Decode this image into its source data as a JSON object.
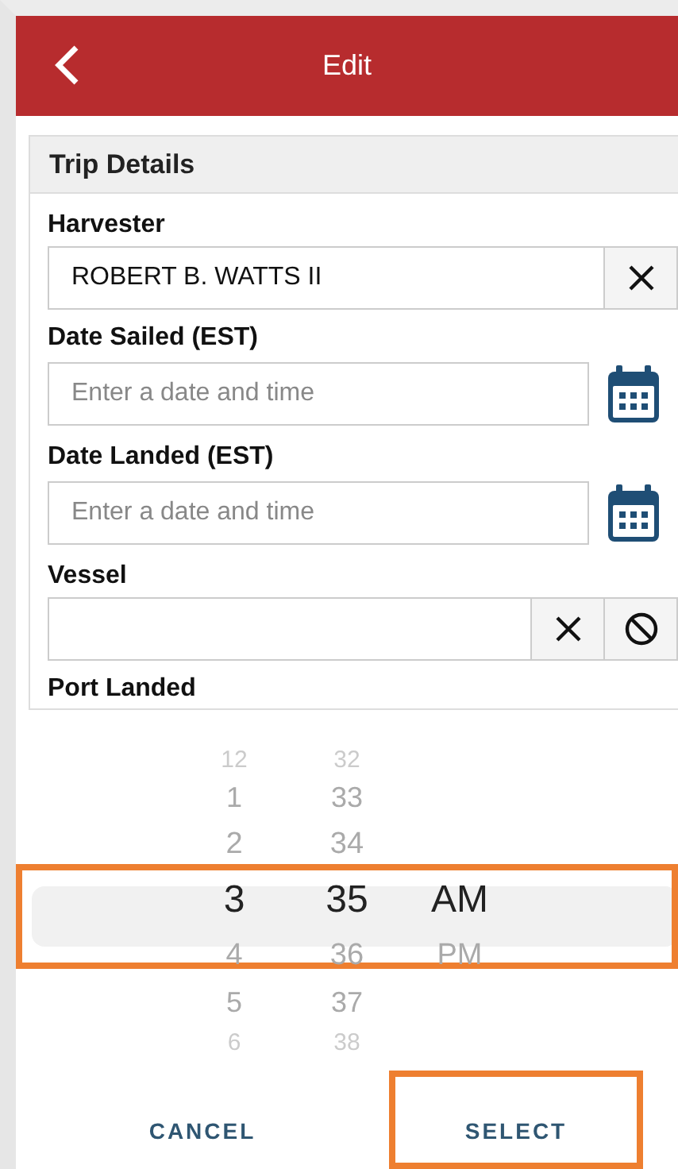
{
  "header": {
    "title": "Edit"
  },
  "section": {
    "title": "Trip Details",
    "fields": [
      {
        "kind": "select",
        "label": "Harvester",
        "value": "ROBERT B. WATTS II",
        "clear": true,
        "disable": false
      },
      {
        "kind": "date",
        "label": "Date Sailed (EST)",
        "placeholder": "Enter a date and time"
      },
      {
        "kind": "date",
        "label": "Date Landed (EST)",
        "placeholder": "Enter a date and time"
      },
      {
        "kind": "select",
        "label": "Vessel",
        "clear": true,
        "disable": true
      }
    ],
    "cut_label": "Port Landed"
  },
  "picker": {
    "columns": [
      {
        "items": [
          {
            "text": "12",
            "selected": false
          },
          {
            "text": "1",
            "selected": false
          },
          {
            "text": "2",
            "selected": false
          },
          {
            "text": "3",
            "selected": true
          },
          {
            "text": "4",
            "selected": false
          },
          {
            "text": "5",
            "selected": false
          },
          {
            "text": "6",
            "selected": false
          }
        ]
      },
      {
        "items": [
          {
            "text": "32",
            "selected": false
          },
          {
            "text": "33",
            "selected": false
          },
          {
            "text": "34",
            "selected": false
          },
          {
            "text": "35",
            "selected": true
          },
          {
            "text": "36",
            "selected": false
          },
          {
            "text": "37",
            "selected": false
          },
          {
            "text": "38",
            "selected": false
          }
        ]
      },
      {
        "items": [
          {
            "text": "AM",
            "selected": true
          },
          {
            "text": "PM",
            "selected": false
          }
        ]
      }
    ]
  },
  "actions": [
    {
      "label": "CANCEL",
      "highlighted": false
    },
    {
      "label": "SELECT",
      "highlighted": true
    }
  ]
}
